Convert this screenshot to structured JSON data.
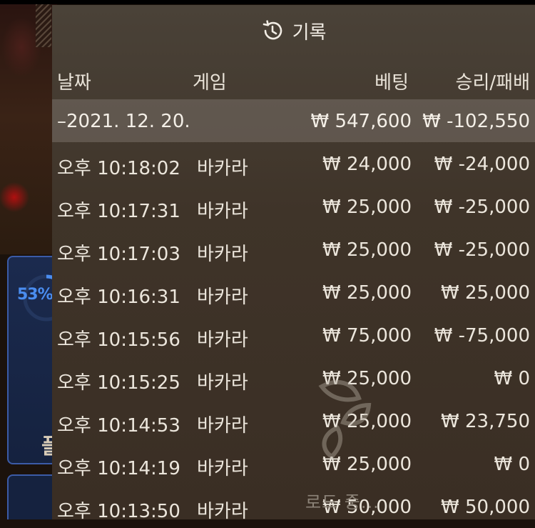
{
  "background": {
    "percent_label": "53%",
    "player_label": "플"
  },
  "panel": {
    "title": "기록",
    "columns": {
      "date": "날짜",
      "game": "게임",
      "bet": "베팅",
      "result": "승리/패배"
    },
    "date_group": {
      "date": "–2021. 12. 20.",
      "bet": "₩ 547,600",
      "result": "₩ -102,550"
    },
    "rows": [
      {
        "time": "오후 10:18:02",
        "game": "바카라",
        "bet": "₩ 24,000",
        "result": "₩ -24,000"
      },
      {
        "time": "오후 10:17:31",
        "game": "바카라",
        "bet": "₩ 25,000",
        "result": "₩ -25,000"
      },
      {
        "time": "오후 10:17:03",
        "game": "바카라",
        "bet": "₩ 25,000",
        "result": "₩ -25,000"
      },
      {
        "time": "오후 10:16:31",
        "game": "바카라",
        "bet": "₩ 25,000",
        "result": "₩ 25,000"
      },
      {
        "time": "오후 10:15:56",
        "game": "바카라",
        "bet": "₩ 75,000",
        "result": "₩ -75,000"
      },
      {
        "time": "오후 10:15:25",
        "game": "바카라",
        "bet": "₩ 25,000",
        "result": "₩ 0"
      },
      {
        "time": "오후 10:14:53",
        "game": "바카라",
        "bet": "₩ 25,000",
        "result": "₩ 23,750"
      },
      {
        "time": "오후 10:14:19",
        "game": "바카라",
        "bet": "₩ 25,000",
        "result": "₩ 0"
      },
      {
        "time": "오후 10:13:50",
        "game": "바카라",
        "bet": "₩ 50,000",
        "result": "₩ 50,000"
      }
    ],
    "loading_text": "로드 중..."
  },
  "colors": {
    "panel_bg": "#3f3429",
    "date_row_bg": "#787068",
    "accent_blue": "#4a8df0",
    "text": "#ece6dc"
  },
  "icons": {
    "header": "history-clock-icon",
    "loader": "leaf-loader-icon"
  }
}
